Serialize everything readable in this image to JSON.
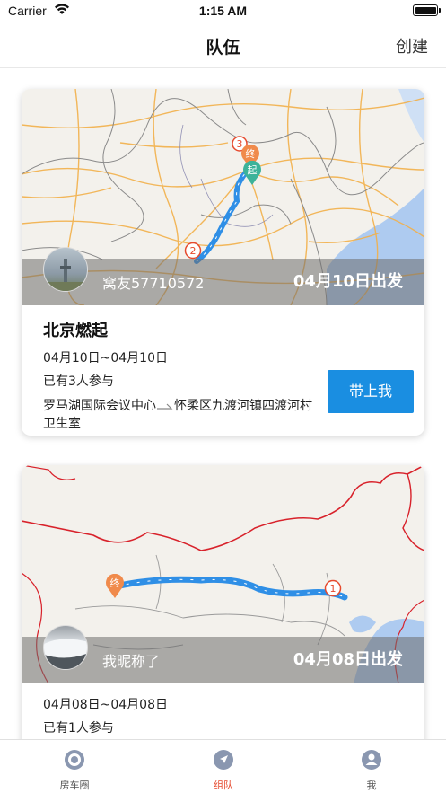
{
  "status": {
    "carrier": "Carrier",
    "time": "1:15 AM"
  },
  "nav": {
    "title": "队伍",
    "create_label": "创建"
  },
  "cards": [
    {
      "owner": "窝友57710572",
      "depart": "04月10日出发",
      "title": "北京燃起",
      "dates": "04月10日~04月10日",
      "participants": "已有3人参与",
      "route_from": "罗马湖国际会议中心",
      "route_to": "怀柔区九渡河镇四渡河村卫生室",
      "join_label": "带上我",
      "markers": [
        "3",
        "终",
        "起",
        "2"
      ]
    },
    {
      "owner": "我昵称了",
      "depart": "04月08日出发",
      "dates": "04月08日~04月08日",
      "participants": "已有1人参与",
      "markers": [
        "终",
        "1"
      ]
    }
  ],
  "tabs": [
    {
      "label": "房车圈",
      "icon": "circle-target-icon"
    },
    {
      "label": "组队",
      "icon": "navigation-arrow-icon"
    },
    {
      "label": "我",
      "icon": "user-icon"
    }
  ],
  "colors": {
    "accent": "#e64a2e",
    "button": "#1a8ee1",
    "route": "#2f8fe6",
    "marker_orange": "#f08a4b",
    "marker_green": "#3cb39a"
  }
}
